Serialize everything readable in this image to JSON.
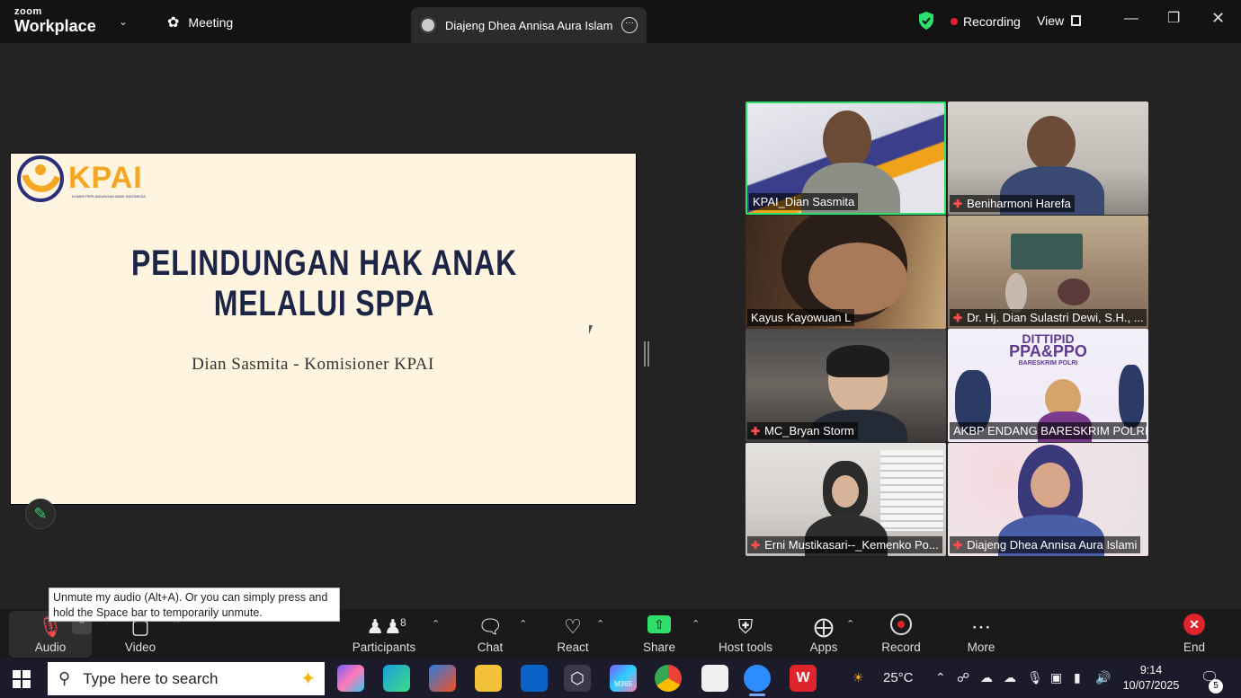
{
  "titlebar": {
    "logo_top": "zoom",
    "logo_bottom": "Workplace",
    "meeting_label": "Meeting",
    "tab_title": "Diajeng Dhea Annisa Aura Islami's",
    "recording_label": "Recording",
    "view_label": "View"
  },
  "slide": {
    "logo_text": "KPAI",
    "logo_subtext": "KOMISI PERLINDUNGAN ANAK INDONESIA",
    "title": "PELINDUNGAN HAK ANAK MELALUI SPPA",
    "author": "Dian Sasmita - Komisioner KPAI"
  },
  "participants": [
    {
      "name": "KPAI_Dian Sasmita",
      "muted": false,
      "active": true
    },
    {
      "name": "Beniharmoni Harefa",
      "muted": true,
      "active": false
    },
    {
      "name": "Kayus Kayowuan L",
      "muted": false,
      "active": false
    },
    {
      "name": "Dr. Hj. Dian Sulastri Dewi, S.H., ...",
      "muted": true,
      "active": false
    },
    {
      "name": "MC_Bryan Storm",
      "muted": true,
      "active": false
    },
    {
      "name": "AKBP ENDANG BARESKRIM POLRI",
      "muted": false,
      "active": false
    },
    {
      "name": "Erni Mustikasari--_Kemenko Po...",
      "muted": true,
      "active": false
    },
    {
      "name": "Diajeng Dhea Annisa Aura Islami",
      "muted": true,
      "active": false
    }
  ],
  "tile_texts": {
    "banner_line1": "DITTIPID",
    "banner_line2": "PPA&PPO",
    "banner_line3": "BARESKRIM POLRI"
  },
  "tooltip": "Unmute my audio (Alt+A). Or you can simply press and hold the Space bar to temporarily unmute.",
  "toolbar": {
    "audio": "Audio",
    "video": "Video",
    "participants": "Participants",
    "participants_count": "8",
    "chat": "Chat",
    "react": "React",
    "share": "Share",
    "host_tools": "Host tools",
    "apps": "Apps",
    "record": "Record",
    "more": "More",
    "end": "End"
  },
  "taskbar": {
    "search_placeholder": "Type here to search",
    "weather": "25°C",
    "time": "9:14",
    "date": "10/07/2025",
    "notification_count": "5",
    "m365_label": "M365"
  },
  "colors": {
    "active_border": "#2ee06b",
    "mute_red": "#ff4d4f",
    "record_red": "#e0242b",
    "slide_bg": "#fef4df",
    "slide_title": "#1d2547",
    "kpai_orange": "#f5a623"
  }
}
